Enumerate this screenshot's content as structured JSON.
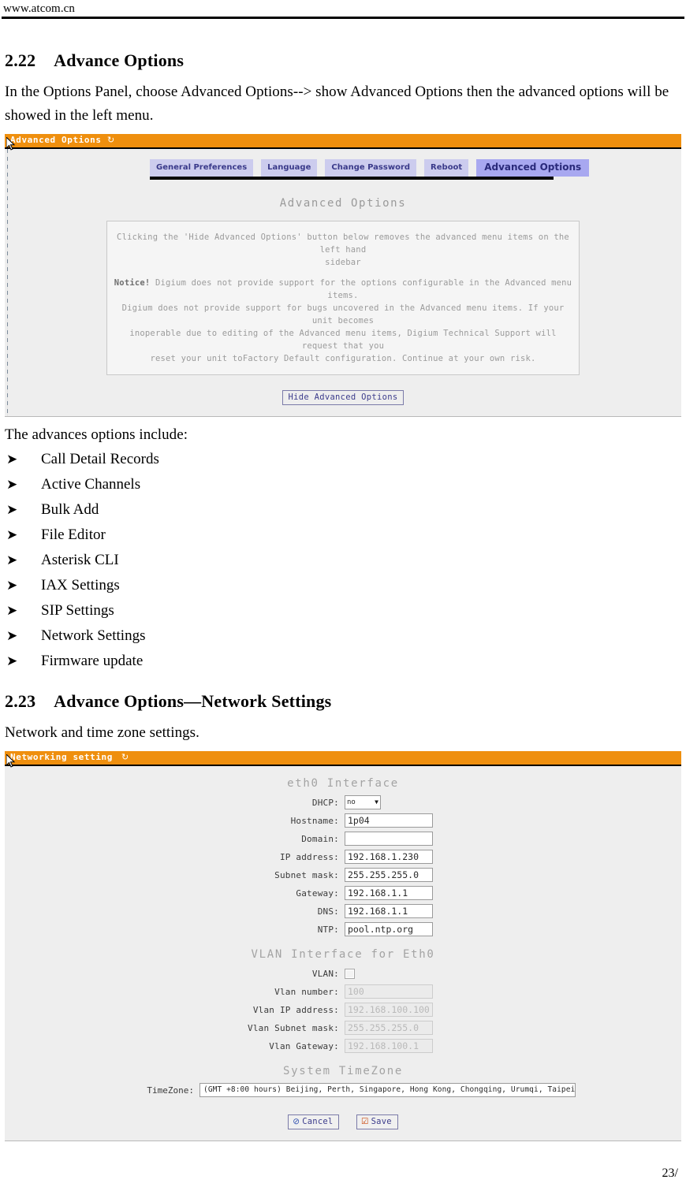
{
  "page": {
    "header_url": "www.atcom.cn",
    "footer_page": "23/"
  },
  "sections": {
    "s222": {
      "number": "2.22",
      "title": "Advance Options",
      "intro": "In the Options Panel, choose Advanced Options--> show Advanced Options then the advanced options will be showed in the left menu.",
      "list_intro": "The advances options include:",
      "bullet_glyph": "➤",
      "items": [
        "Call Detail Records",
        "Active Channels",
        "Bulk Add",
        "File Editor",
        "Asterisk CLI",
        "IAX Settings",
        "SIP Settings",
        "Network Settings",
        "Firmware update"
      ]
    },
    "s223": {
      "number": "2.23",
      "title": "Advance Options—Network Settings",
      "intro": "Network and time zone settings."
    }
  },
  "screenshot_advanced": {
    "titlebar": {
      "label": "Advanced Options",
      "refresh_icon": "↻"
    },
    "tabs": [
      {
        "label": "General Preferences",
        "active": false
      },
      {
        "label": "Language",
        "active": false
      },
      {
        "label": "Change Password",
        "active": false
      },
      {
        "label": "Reboot",
        "active": false
      },
      {
        "label": "Advanced Options",
        "active": true
      }
    ],
    "page_title": "Advanced Options",
    "notice": {
      "line1": "Clicking the 'Hide Advanced Options' button below removes the advanced menu items on the left hand",
      "line2": "sidebar",
      "bold_prefix": "Notice!",
      "line3": " Digium does not provide support for the options configurable in the Advanced menu items.",
      "line4": "Digium does not provide support for bugs uncovered in the Advanced menu items. If your unit becomes",
      "line5": "inoperable due to editing of the Advanced menu items, Digium Technical Support will request that you",
      "line6": "reset your unit toFactory Default configuration. Continue at your own risk."
    },
    "hide_button": "Hide Advanced Options"
  },
  "screenshot_network": {
    "titlebar": {
      "label": "Networking setting",
      "refresh_icon": "↻"
    },
    "eth0": {
      "heading": "eth0 Interface",
      "fields": [
        {
          "label": "DHCP:",
          "value": "no",
          "type": "select",
          "disabled": false
        },
        {
          "label": "Hostname:",
          "value": "1p04",
          "type": "text",
          "disabled": false
        },
        {
          "label": "Domain:",
          "value": "",
          "type": "text",
          "disabled": false
        },
        {
          "label": "IP address:",
          "value": "192.168.1.230",
          "type": "text",
          "disabled": false
        },
        {
          "label": "Subnet mask:",
          "value": "255.255.255.0",
          "type": "text",
          "disabled": false
        },
        {
          "label": "Gateway:",
          "value": "192.168.1.1",
          "type": "text",
          "disabled": false
        },
        {
          "label": "DNS:",
          "value": "192.168.1.1",
          "type": "text",
          "disabled": false
        },
        {
          "label": "NTP:",
          "value": "pool.ntp.org",
          "type": "text",
          "disabled": false
        }
      ]
    },
    "vlan": {
      "heading": "VLAN Interface for Eth0",
      "checkbox_label": "VLAN:",
      "checkbox_checked": false,
      "fields": [
        {
          "label": "Vlan number:",
          "value": "100",
          "type": "text",
          "disabled": true
        },
        {
          "label": "Vlan IP address:",
          "value": "192.168.100.100",
          "type": "text",
          "disabled": true
        },
        {
          "label": "Vlan Subnet mask:",
          "value": "255.255.255.0",
          "type": "text",
          "disabled": true
        },
        {
          "label": "Vlan Gateway:",
          "value": "192.168.100.1",
          "type": "text",
          "disabled": true
        }
      ]
    },
    "timezone": {
      "heading": "System TimeZone",
      "label": "TimeZone:",
      "value": "(GMT +8:00 hours) Beijing, Perth, Singapore, Hong Kong, Chongqing, Urumqi, Taipei",
      "caret": "▼"
    },
    "buttons": {
      "cancel": "Cancel",
      "cancel_icon": "⊘",
      "save": "Save",
      "save_icon": "☑"
    }
  },
  "colors": {
    "titlebar_orange": "#ef8f0e",
    "tab_bg": "#ccccee",
    "tab_active_bg": "#a8a8f0",
    "shot_bg": "#eeeeee"
  }
}
